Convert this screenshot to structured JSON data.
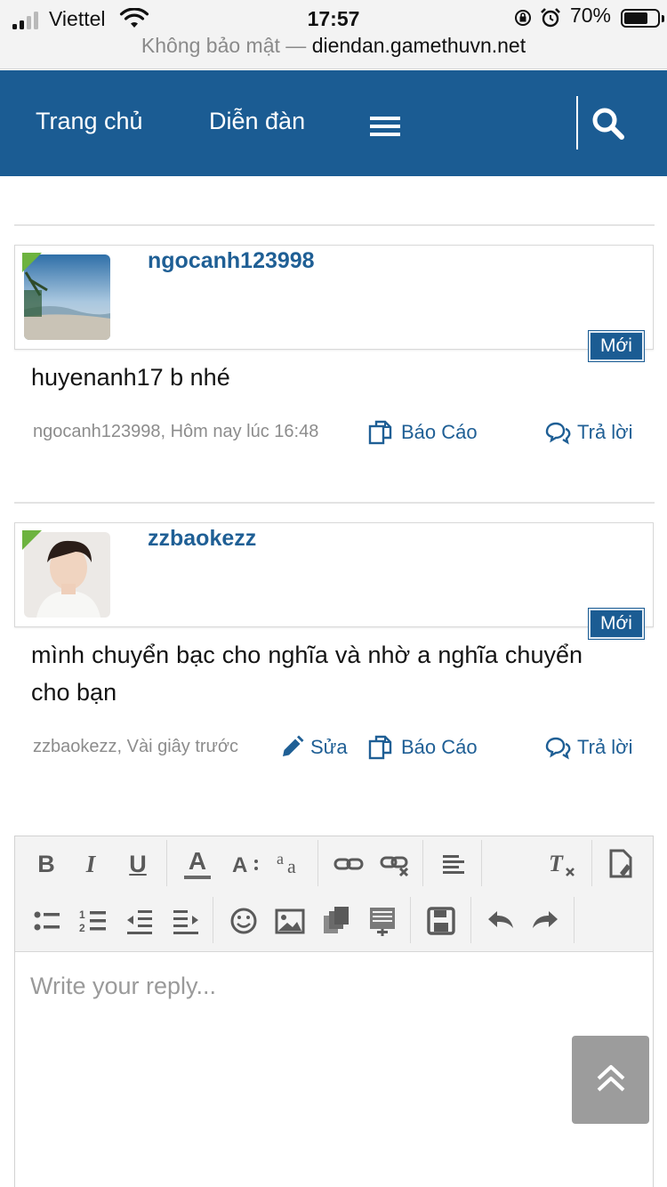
{
  "status_bar": {
    "carrier": "Viettel",
    "time": "17:57",
    "battery": "70%",
    "battery_level": 0.7,
    "icons": [
      "signal-icon",
      "wifi-icon",
      "orientation-lock-icon",
      "alarm-icon",
      "battery-icon"
    ]
  },
  "url_bar": {
    "security": "Không bảo mật —",
    "host": "diendan.gamethuvn.net"
  },
  "nav": {
    "home": "Trang chủ",
    "forums": "Diễn đàn",
    "icons": [
      "menu-icon",
      "search-icon"
    ]
  },
  "posts": [
    {
      "username": "ngocanh123998",
      "badge": "Mới",
      "text": "huyenanh17 b nhé",
      "meta": "ngocanh123998, Hôm nay lúc 16:48",
      "report": "Báo Cáo",
      "reply": "Trả lời"
    },
    {
      "username": "zzbaokezz",
      "badge": "Mới",
      "text": "mình chuyển bạc cho nghĩa và nhờ a nghĩa chuyển cho bạn",
      "meta": "zzbaokezz, Vài giây trước",
      "edit": "Sửa",
      "report": "Báo Cáo",
      "reply": "Trả lời"
    }
  ],
  "editor": {
    "placeholder": "Write your reply...",
    "toolbar_row1": {
      "bold": "B",
      "italic": "I",
      "underline": "U",
      "font_color": "A"
    }
  },
  "colors": {
    "brand": "#1b5c93",
    "link": "#1f5f95",
    "online": "#6db33f",
    "scroll_button": "#9c9c9c"
  }
}
